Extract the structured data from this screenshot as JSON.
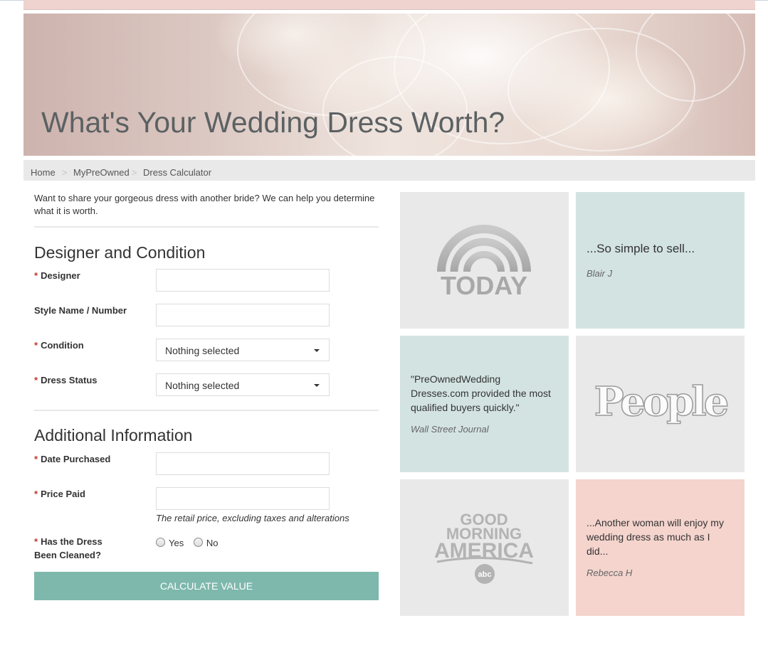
{
  "hero": {
    "title": "What's Your Wedding Dress Worth?"
  },
  "breadcrumb": {
    "home": "Home",
    "section": "MyPreOwned",
    "current": "Dress Calculator",
    "separator": ">"
  },
  "intro": "Want to share your gorgeous dress with another bride? We can help you determine what it is worth.",
  "designer_section": {
    "title": "Designer and Condition",
    "required_marker": "*",
    "designer_label": "Designer",
    "style_label": "Style Name / Number",
    "condition_label": "Condition",
    "condition_value": "Nothing selected",
    "status_label": "Dress Status",
    "status_value": "Nothing selected"
  },
  "additional_section": {
    "title": "Additional Information",
    "date_label": "Date Purchased",
    "price_label": "Price Paid",
    "price_hint": "The retail price, excluding taxes and alterations",
    "cleaned_label_line1": "Has the Dress",
    "cleaned_label_line2": "Been Cleaned?",
    "yes_label": "Yes",
    "no_label": "No"
  },
  "calculate_button": "CALCULATE VALUE",
  "tiles": {
    "today_logo": "TODAY",
    "quote1": {
      "text": "...So simple to sell...",
      "author": "Blair J"
    },
    "quote2": {
      "text": "\"PreOwnedWedding Dresses.com provided the most qualified buyers quickly.\"",
      "author": "Wall Street Journal"
    },
    "people_logo": "People",
    "gma_logo": {
      "line1": "GOOD",
      "line2": "MORNING",
      "line3": "AMERICA",
      "badge": "abc"
    },
    "quote3": {
      "text": "...Another woman will enjoy my wedding dress as much as I did...",
      "author": "Rebecca H"
    }
  },
  "colors": {
    "accent": "#7eb8ad",
    "mint": "#d3e3e2",
    "pink": "#f4d4cd",
    "grey": "#e9e9e9",
    "required": "#c0392b"
  }
}
